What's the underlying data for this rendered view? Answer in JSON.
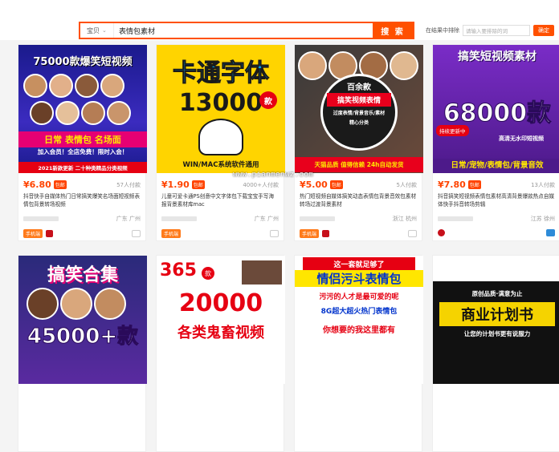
{
  "search": {
    "scope": "宝贝",
    "query": "表情包素材",
    "button": "搜 索"
  },
  "exclude": {
    "label": "在结果中排除",
    "placeholder": "请输入要排除的词",
    "button": "确定"
  },
  "watermark": "www.pianmenwz.com",
  "products": [
    {
      "price": "¥6.80",
      "badge": "包邮",
      "paid": "57人付款",
      "title": "抖音快手自媒体热门日常搞笑爆笑名场面短视频表情包背景转场视频",
      "location": "广东 广州",
      "img": {
        "top": "75000款爆笑短视频",
        "mid": "日常 表情包 名场面",
        "sub": "加入会员！全店免费！限时入会！",
        "foot": "2021新款更新  二十种类精品分类视频"
      },
      "colors": {
        "bg": "#1a1a8c",
        "accent": "#ffe600"
      }
    },
    {
      "price": "¥1.90",
      "badge": "包邮",
      "paid": "4000+人付款",
      "title": "儿童可爱卡通PS创意中文字体包下载宝宝手写海报背景素材库mac",
      "location": "广东 广州",
      "img": {
        "top": "卡通字体",
        "num": "13000",
        "unit": "款",
        "foot": "WIN/MAC系统软件通用"
      },
      "colors": {
        "bg": "#ffd400",
        "accent": "#e60012"
      }
    },
    {
      "price": "¥5.00",
      "badge": "包邮",
      "paid": "5人付款",
      "title": "热门短视频自媒体搞笑动态表情包背景音效包素材转场过渡背景素材",
      "location": "浙江 杭州",
      "img": {
        "top": "百余款",
        "mid": "搞笑视频表情",
        "sub": "过度表情/背景音乐/素材",
        "sub2": "精心分类",
        "foot": "天猫品质 值得信赖 24h自动发货"
      },
      "colors": {
        "bg": "#2b2b2b",
        "accent": "#e8001c"
      }
    },
    {
      "price": "¥7.80",
      "badge": "包邮",
      "paid": "13人付款",
      "title": "抖音搞笑短视频表情包素材高清背景爆款热点自媒体快手抖音转场剪辑",
      "location": "江苏 徐州",
      "img": {
        "top": "搞笑短视频素材",
        "num": "68000款",
        "tag": "持续更新中",
        "sub": "高清无水印短视频",
        "foot": "日常/宠物/表情包/背景音效"
      },
      "colors": {
        "bg": "#7a2cc7",
        "accent": "#ffffff"
      }
    },
    {
      "img": {
        "top": "搞笑合集",
        "num": "45000+款"
      },
      "colors": {
        "bg": "#2a2a7a",
        "accent": "#ffffff"
      }
    },
    {
      "img": {
        "top": "365",
        "unit": "款",
        "mid": "20000",
        "sub": "各类鬼畜视频"
      },
      "colors": {
        "bg": "#ffffff",
        "accent": "#e60012"
      }
    },
    {
      "img": {
        "top": "这一套就足够了",
        "mid": "情侣污斗表情包",
        "sub": "污污的人才是最可爱的呢",
        "sub2": "8G超大超火热门表情包",
        "foot": "你想要的我这里都有"
      },
      "colors": {
        "bg": "#ffffff",
        "accent": "#0033cc"
      }
    },
    {
      "img": {
        "top": "原创品质·满意为止",
        "mid": "商业计划书",
        "sub": "让您的计划书更有说服力"
      },
      "colors": {
        "bg": "#111111",
        "accent": "#f5d300"
      }
    }
  ]
}
